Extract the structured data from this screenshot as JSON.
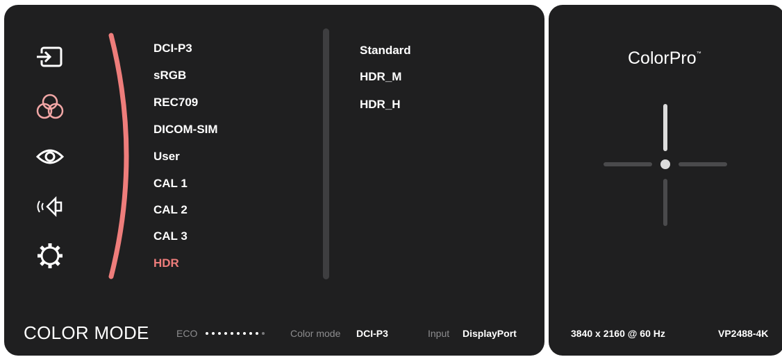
{
  "sidebar": {
    "icons": [
      {
        "name": "input-icon"
      },
      {
        "name": "color-icon"
      },
      {
        "name": "eye-icon"
      },
      {
        "name": "audio-icon"
      },
      {
        "name": "settings-icon"
      }
    ]
  },
  "menu": {
    "items": [
      "DCI-P3",
      "sRGB",
      "REC709",
      "DICOM-SIM",
      "User",
      "CAL 1",
      "CAL 2",
      "CAL 3",
      "HDR"
    ],
    "selected": "HDR",
    "accent_color": "#ee7d7b"
  },
  "submenu": {
    "items": [
      "Standard",
      "HDR_M",
      "HDR_H"
    ]
  },
  "footer": {
    "title": "COLOR MODE",
    "eco_label": "ECO",
    "eco_level": 0.9,
    "color_mode_label": "Color mode",
    "color_mode_value": "DCI-P3",
    "input_label": "Input",
    "input_value": "DisplayPort"
  },
  "side_panel": {
    "brand": "ColorPro",
    "trademark": "™",
    "resolution": "3840 x 2160 @ 60 Hz",
    "model": "VP2488-4K"
  }
}
